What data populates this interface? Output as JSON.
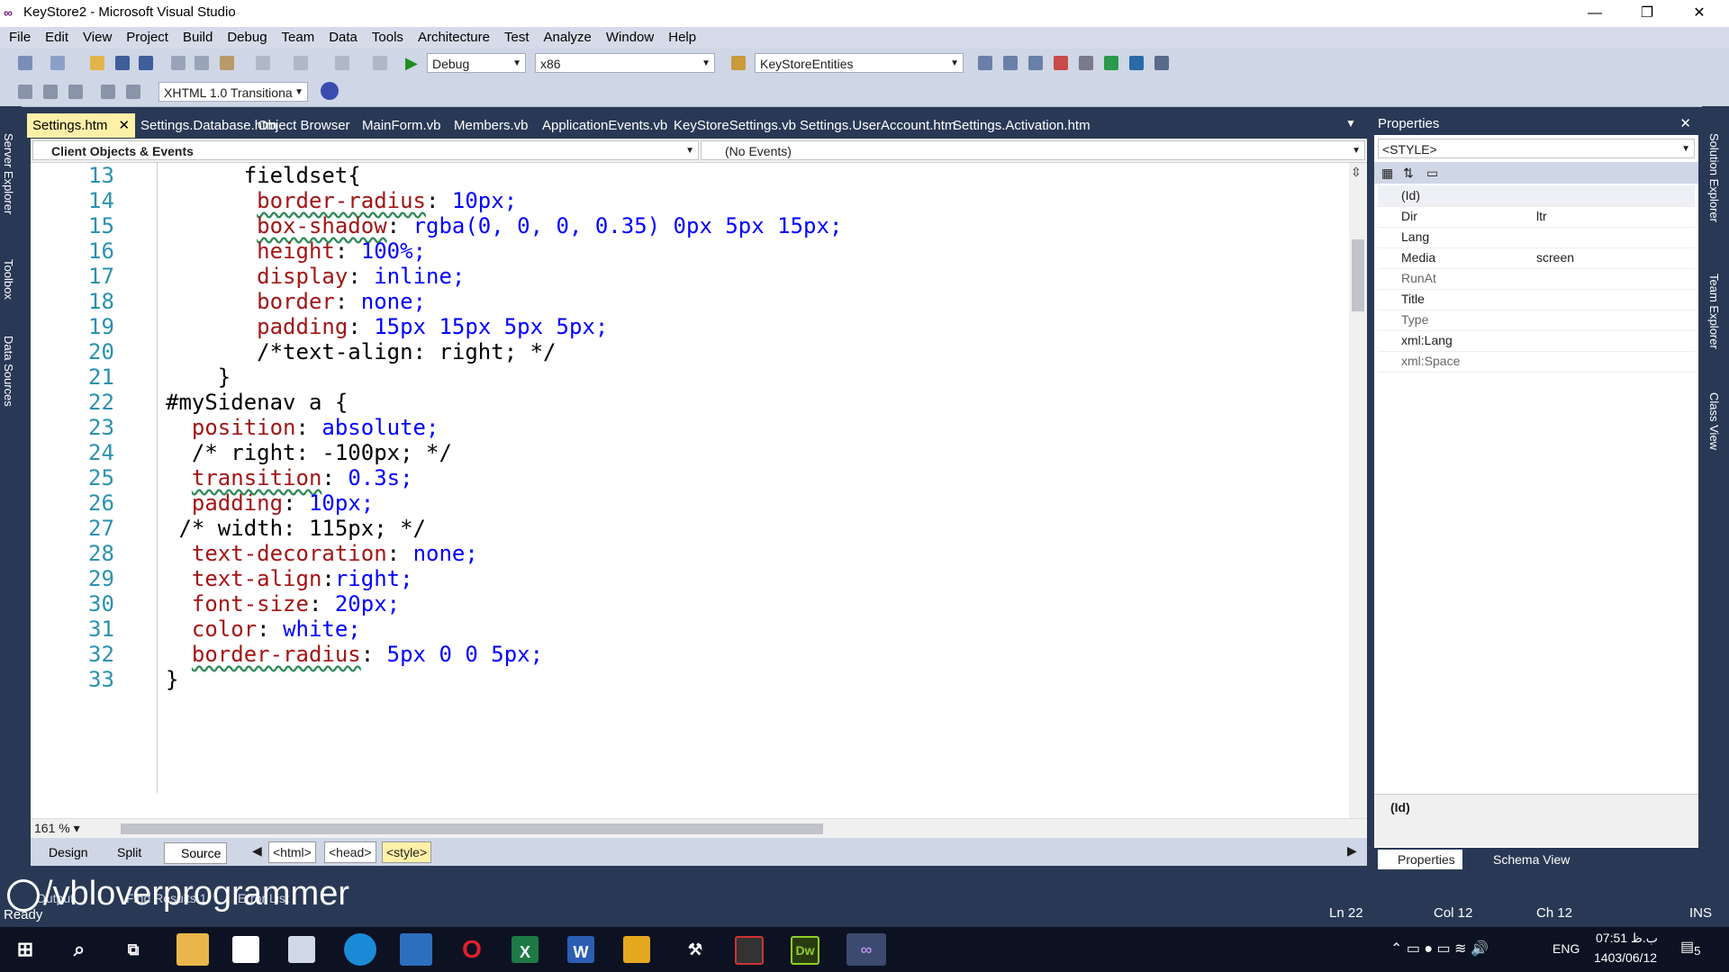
{
  "window": {
    "title": "KeyStore2 - Microsoft Visual Studio"
  },
  "menu": [
    "File",
    "Edit",
    "View",
    "Project",
    "Build",
    "Debug",
    "Team",
    "Data",
    "Tools",
    "Architecture",
    "Test",
    "Analyze",
    "Window",
    "Help"
  ],
  "toolbar": {
    "config": "Debug",
    "platform": "x86",
    "entities": "KeyStoreEntities",
    "doctype": "XHTML 1.0 Transitiona"
  },
  "left_tabs": [
    "Server Explorer",
    "Toolbox",
    "Data Sources"
  ],
  "right_tabs": [
    "Solution Explorer",
    "Team Explorer",
    "Class View"
  ],
  "doc_tabs": [
    "Settings.htm",
    "Settings.Database.htm",
    "Object Browser",
    "MainForm.vb",
    "Members.vb",
    "ApplicationEvents.vb",
    "KeyStoreSettings.vb",
    "Settings.UserAccount.htm",
    "Settings.Activation.htm"
  ],
  "nav": {
    "objects": "Client Objects & Events",
    "events": "(No Events)"
  },
  "code": {
    "line_numbers": [
      "13",
      "14",
      "15",
      "16",
      "17",
      "18",
      "19",
      "20",
      "21",
      "22",
      "23",
      "24",
      "25",
      "26",
      "27",
      "28",
      "29",
      "30",
      "31",
      "32",
      "33"
    ],
    "lines": [
      {
        "indent": "      ",
        "prop": "",
        "val": "",
        "text": "fieldset{"
      },
      {
        "indent": "       ",
        "prop": "border-radius",
        "val": "10px;"
      },
      {
        "indent": "       ",
        "prop": "box-shadow",
        "val": "rgba(0, 0, 0, 0.35) 0px 5px 15px;"
      },
      {
        "indent": "       ",
        "prop": "height",
        "val": "100%;"
      },
      {
        "indent": "       ",
        "prop": "display",
        "val": "inline;"
      },
      {
        "indent": "       ",
        "prop": "border",
        "val": "none;"
      },
      {
        "indent": "       ",
        "prop": "padding",
        "val": "15px 15px 5px 5px;"
      },
      {
        "indent": "       ",
        "prop": "",
        "val": "",
        "text": "/*text-align: right; */"
      },
      {
        "indent": "    ",
        "prop": "",
        "val": "",
        "text": "}"
      },
      {
        "indent": "",
        "prop": "",
        "val": "",
        "text": "#mySidenav a {"
      },
      {
        "indent": "  ",
        "prop": "position",
        "val": "absolute;"
      },
      {
        "indent": "  ",
        "prop": "",
        "val": "",
        "text": "/* right: -100px; */"
      },
      {
        "indent": "  ",
        "prop": "transition",
        "val": "0.3s;"
      },
      {
        "indent": "  ",
        "prop": "padding",
        "val": "10px;"
      },
      {
        "indent": " ",
        "prop": "",
        "val": "",
        "text": "/* width: 115px; */"
      },
      {
        "indent": "  ",
        "prop": "text-decoration",
        "val": "none;"
      },
      {
        "indent": "  ",
        "prop": "text-align",
        "val": "right;",
        "nospace": true
      },
      {
        "indent": "  ",
        "prop": "font-size",
        "val": "20px;"
      },
      {
        "indent": "  ",
        "prop": "color",
        "val": "white;"
      },
      {
        "indent": "  ",
        "prop": "border-radius",
        "val": "5px 0 0 5px;"
      },
      {
        "indent": "",
        "prop": "",
        "val": "",
        "text": "}"
      }
    ]
  },
  "zoom": "161 %",
  "views": [
    "Design",
    "Split",
    "Source"
  ],
  "breadcrumbs": [
    "<html>",
    "<head>",
    "<style>"
  ],
  "properties": {
    "title": "Properties",
    "selector": "<STYLE>",
    "rows": [
      {
        "k": "(Id)",
        "v": ""
      },
      {
        "k": "Dir",
        "v": "ltr"
      },
      {
        "k": "Lang",
        "v": ""
      },
      {
        "k": "Media",
        "v": "screen"
      },
      {
        "k": "RunAt",
        "v": ""
      },
      {
        "k": "Title",
        "v": ""
      },
      {
        "k": "Type",
        "v": ""
      },
      {
        "k": "xml:Lang",
        "v": ""
      },
      {
        "k": "xml:Space",
        "v": ""
      }
    ],
    "desc": "(Id)",
    "tabs": [
      "Properties",
      "Schema View"
    ]
  },
  "output_tabs": [
    "Output",
    "Find Results 1",
    "Error List"
  ],
  "status": {
    "ready": "Ready",
    "ln": "Ln 22",
    "col": "Col 12",
    "ch": "Ch 12",
    "ins": "INS"
  },
  "watermark": "/vbloverprogrammer",
  "taskbar": {
    "lang": "ENG",
    "time": "07:51 ب.ظ",
    "date": "1403/06/12",
    "notif": "5"
  }
}
